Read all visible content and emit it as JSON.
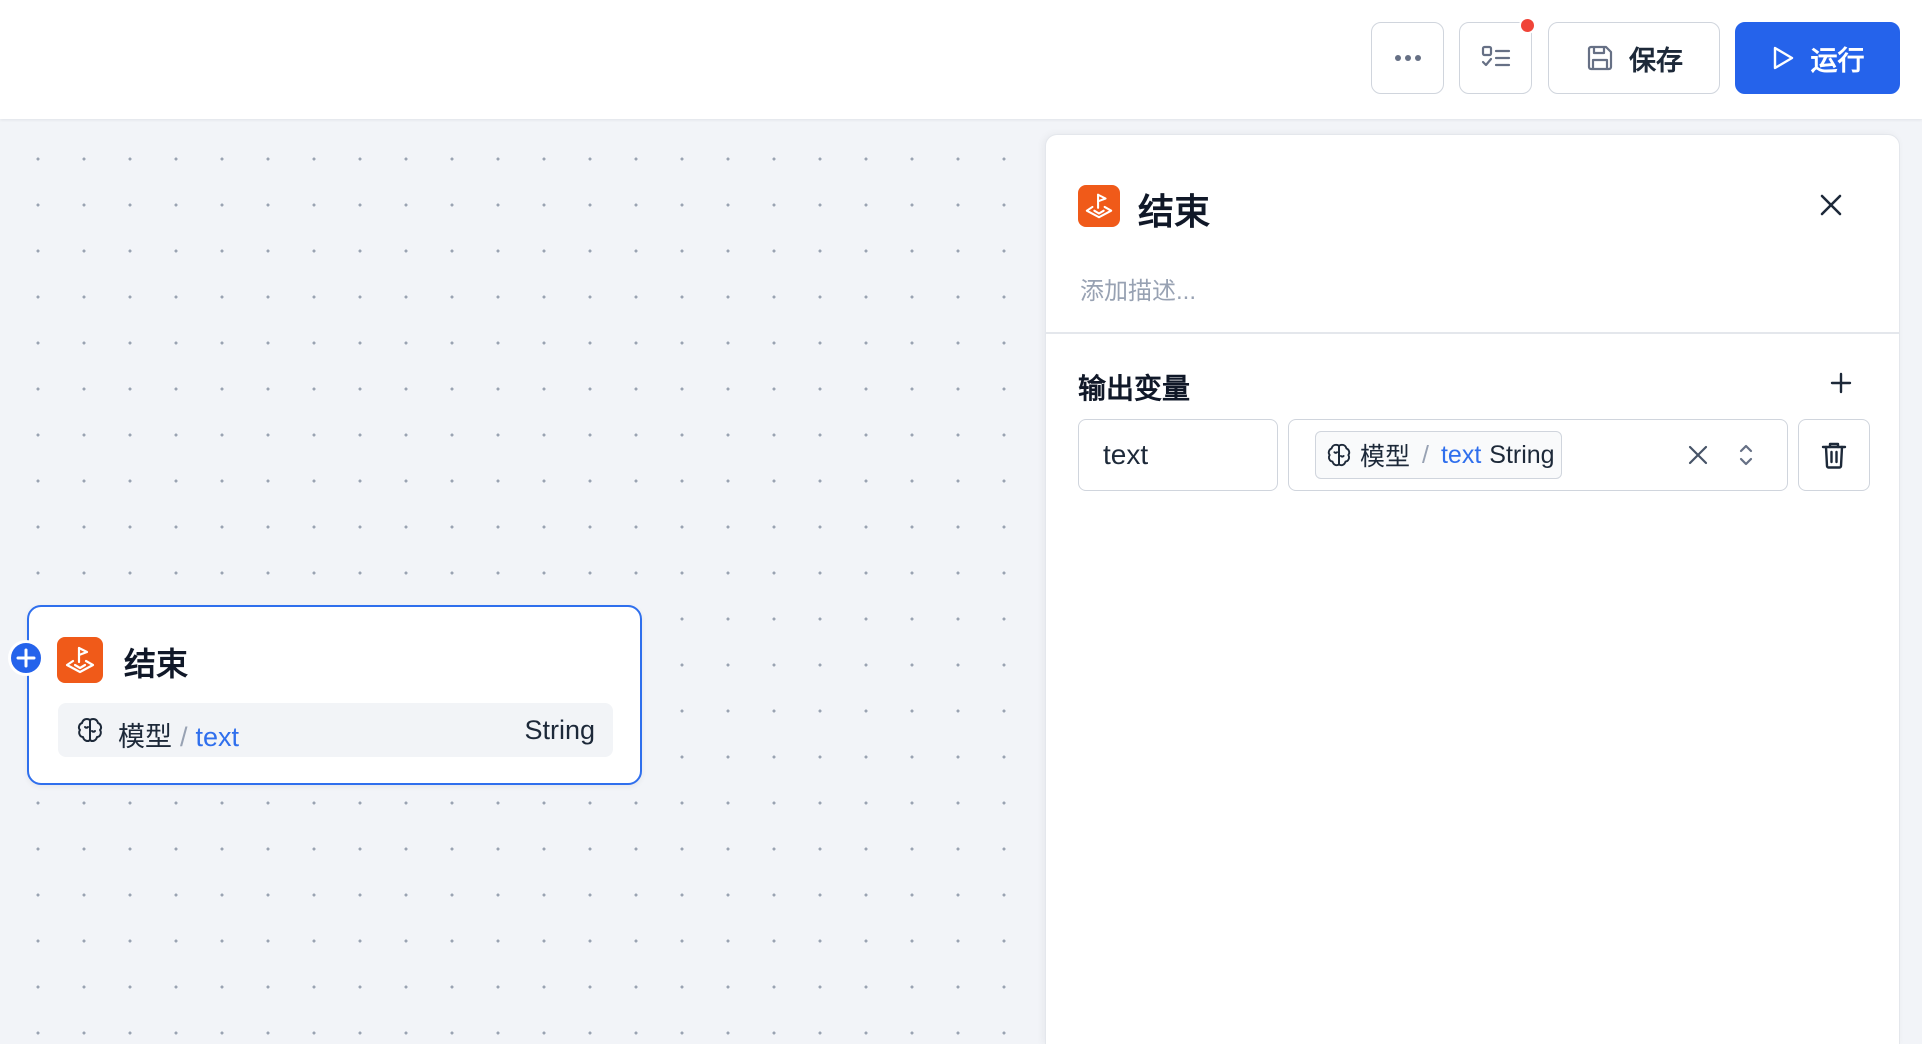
{
  "toolbar": {
    "save_label": "保存",
    "run_label": "运行",
    "checklist_badge_color": "#f04438",
    "accent_color": "#2563eb"
  },
  "node": {
    "title": "结束",
    "icon": "end-flag-icon",
    "output": {
      "source": "模型",
      "separator": "/",
      "variable": "text",
      "type": "String"
    }
  },
  "panel": {
    "title": "结束",
    "icon": "end-flag-icon",
    "description_placeholder": "添加描述...",
    "section_title": "输出变量",
    "outputs": [
      {
        "name": "text",
        "ref_source": "模型",
        "ref_separator": "/",
        "ref_variable": "text",
        "ref_type": "String"
      }
    ]
  }
}
